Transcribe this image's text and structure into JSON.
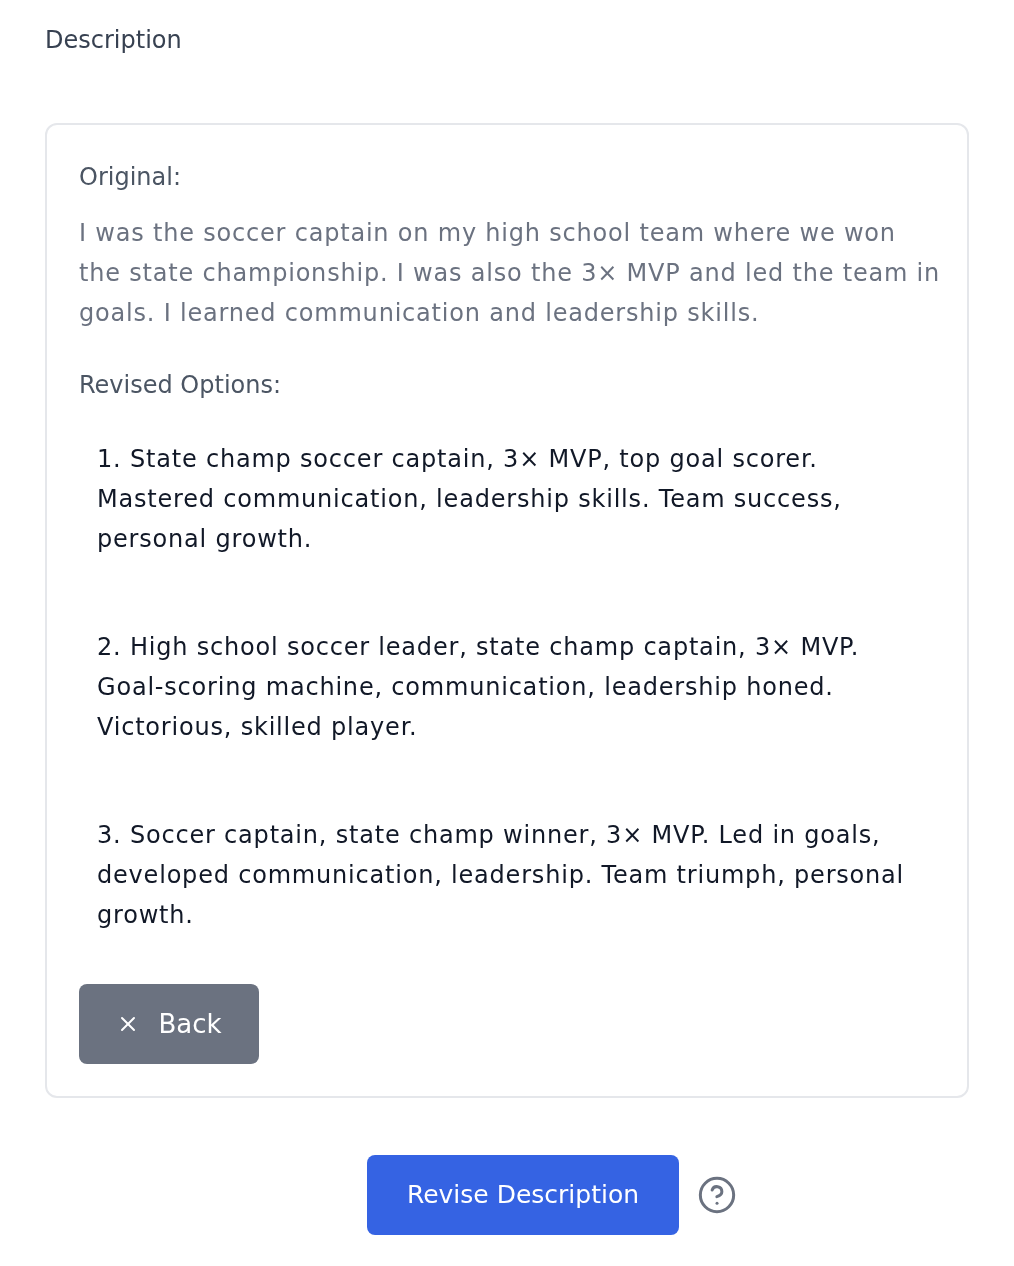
{
  "section_label": "Description",
  "card": {
    "original_label": "Original:",
    "original_text": "I was the soccer captain on my high school team where we won the state championship. I was also the 3× MVP and led the team in goals. I learned communication and leadership skills.",
    "revised_label": "Revised Options:",
    "options": [
      "1. State champ soccer captain, 3× MVP, top goal scorer. Mastered communication, leadership skills. Team success, personal growth.",
      "2. High school soccer leader, state champ captain, 3× MVP. Goal-scoring machine, communication, leadership honed. Victorious, skilled player.",
      "3. Soccer captain, state champ winner, 3× MVP. Led in goals, developed communication, leadership. Team triumph, personal growth."
    ],
    "back_button": "Back"
  },
  "revise_button": "Revise Description"
}
